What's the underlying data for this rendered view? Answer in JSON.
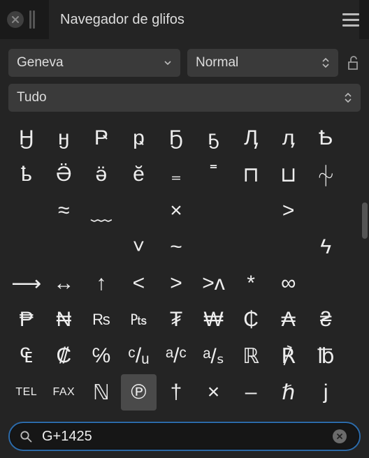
{
  "header": {
    "title": "Navegador de glifos"
  },
  "font_select": {
    "value": "Geneva"
  },
  "style_select": {
    "value": "Normal"
  },
  "filter_select": {
    "value": "Tudo"
  },
  "glyphs": [
    [
      "Ӈ",
      "ӈ",
      "Ҏ",
      "ҏ",
      "Ҕ",
      "ҕ",
      "Ӆ",
      "ӆ",
      "Ҍ"
    ],
    [
      "ҍ",
      "Ӛ",
      "ӛ",
      "ӗ",
      "₌",
      "˭",
      "⊓",
      "⊔",
      "⏆"
    ],
    [
      "",
      "≈",
      "﹏",
      "",
      "×",
      "",
      "",
      "˃",
      ""
    ],
    [
      "",
      "",
      "",
      "˅",
      "~",
      "",
      "",
      "",
      "ϟ"
    ],
    [
      "⟶",
      "↔",
      "↑",
      "<",
      ">",
      ">ʌ",
      "*",
      "∞",
      ""
    ],
    [
      "₱",
      "₦",
      "₨",
      "₧",
      "₮",
      "₩",
      "₵",
      "₳",
      "₴"
    ],
    [
      "₠",
      "₡",
      "℅",
      "ᶜ/ᵤ",
      "ᵃ/ᶜ",
      "ᵃ/ₛ",
      "ℝ",
      "℟",
      "℔"
    ],
    [
      "TEL",
      "FAX",
      "ℕ",
      "℗",
      "†",
      "×",
      "–",
      "ℏ",
      "j"
    ]
  ],
  "selected": {
    "row": 7,
    "col": 3
  },
  "search": {
    "value": "G+1425"
  }
}
